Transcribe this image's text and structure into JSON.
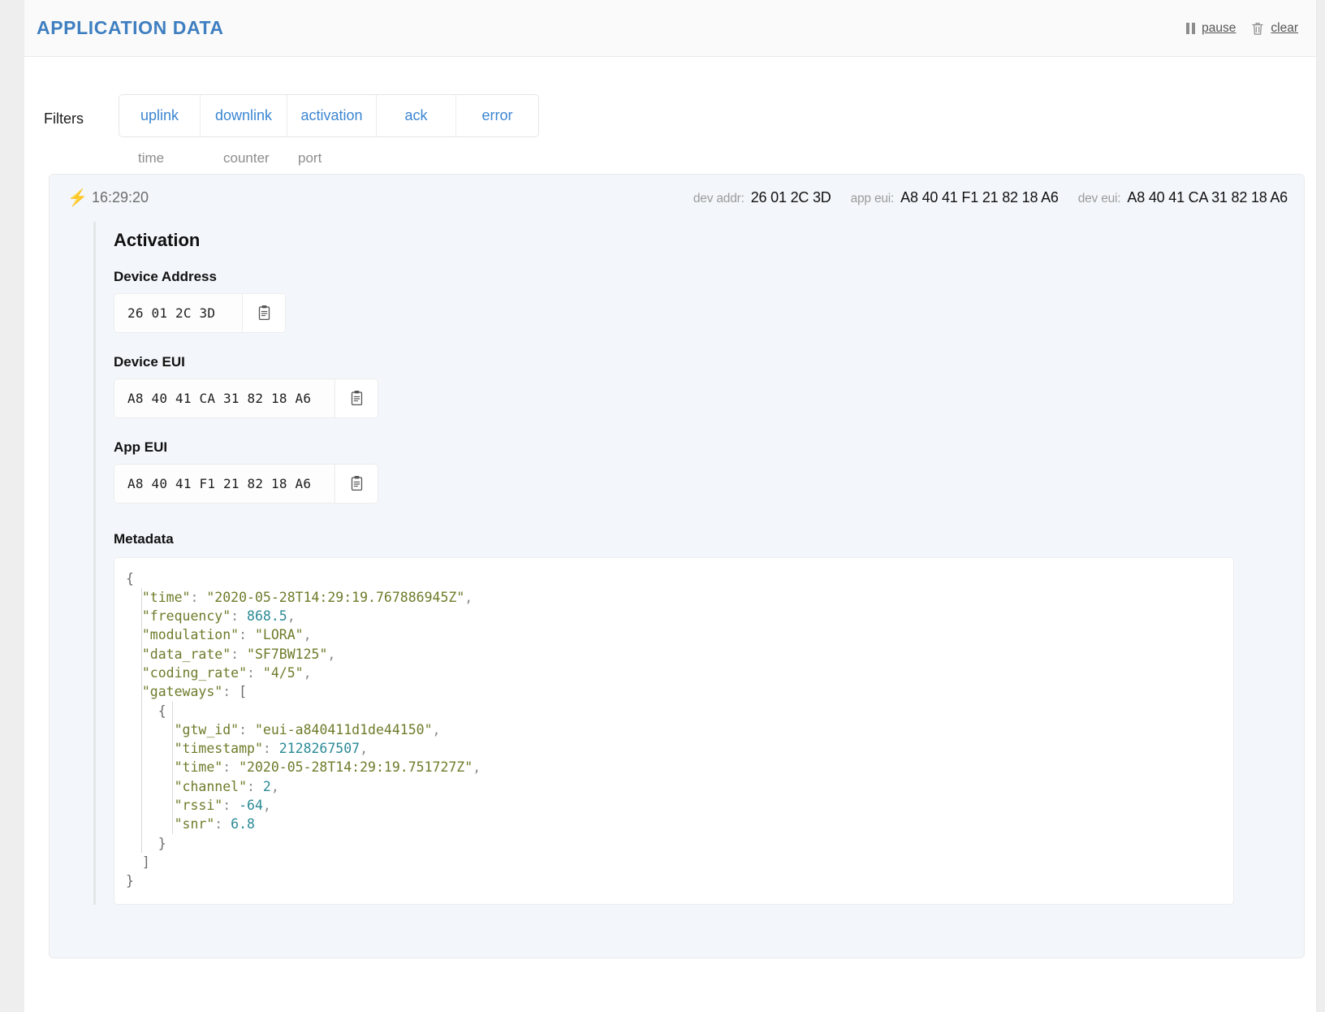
{
  "header": {
    "title": "APPLICATION DATA",
    "pause_label": "pause",
    "clear_label": "clear",
    "pause_icon": "pause-icon",
    "clear_icon": "trash-icon"
  },
  "filters": {
    "label": "Filters",
    "options": [
      {
        "label": "uplink"
      },
      {
        "label": "downlink"
      },
      {
        "label": "activation"
      },
      {
        "label": "ack"
      },
      {
        "label": "error"
      }
    ]
  },
  "columns": {
    "time": "time",
    "counter": "counter",
    "port": "port"
  },
  "event": {
    "type_icon": "lightning-bolt-icon",
    "time": "16:29:20",
    "meta": [
      {
        "key": "dev addr:",
        "value": "26 01 2C 3D"
      },
      {
        "key": "app eui:",
        "value": "A8 40 41 F1 21 82 18 A6"
      },
      {
        "key": "dev eui:",
        "value": "A8 40 41 CA 31 82 18 A6"
      }
    ],
    "section_title": "Activation",
    "fields": [
      {
        "label": "Device Address",
        "value": "26 01 2C 3D",
        "copy_icon": "clipboard-icon"
      },
      {
        "label": "Device EUI",
        "value": "A8 40 41 CA 31 82 18 A6",
        "copy_icon": "clipboard-icon"
      },
      {
        "label": "App EUI",
        "value": "A8 40 41 F1 21 82 18 A6",
        "copy_icon": "clipboard-icon"
      }
    ],
    "metadata_label": "Metadata",
    "metadata": {
      "time": "2020-05-28T14:29:19.767886945Z",
      "frequency": "868.5",
      "modulation": "LORA",
      "data_rate": "SF7BW125",
      "coding_rate": "4/5",
      "gateways": [
        {
          "gtw_id": "eui-a840411d1de44150",
          "timestamp": "2128267507",
          "time": "2020-05-28T14:29:19.751727Z",
          "channel": "2",
          "rssi": "-64",
          "snr": "6.8"
        }
      ]
    },
    "metadata_keys": {
      "time": "\"time\"",
      "frequency": "\"frequency\"",
      "modulation": "\"modulation\"",
      "data_rate": "\"data_rate\"",
      "coding_rate": "\"coding_rate\"",
      "gateways": "\"gateways\"",
      "gtw_id": "\"gtw_id\"",
      "timestamp": "\"timestamp\"",
      "channel": "\"channel\"",
      "rssi": "\"rssi\"",
      "snr": "\"snr\""
    }
  },
  "colors": {
    "brand": "#3f7fc1",
    "link": "#3b86d1",
    "bolt": "#f5b941",
    "json_key": "#6d7c2a",
    "json_number": "#2b8a96",
    "card_bg": "#f3f7fb"
  }
}
